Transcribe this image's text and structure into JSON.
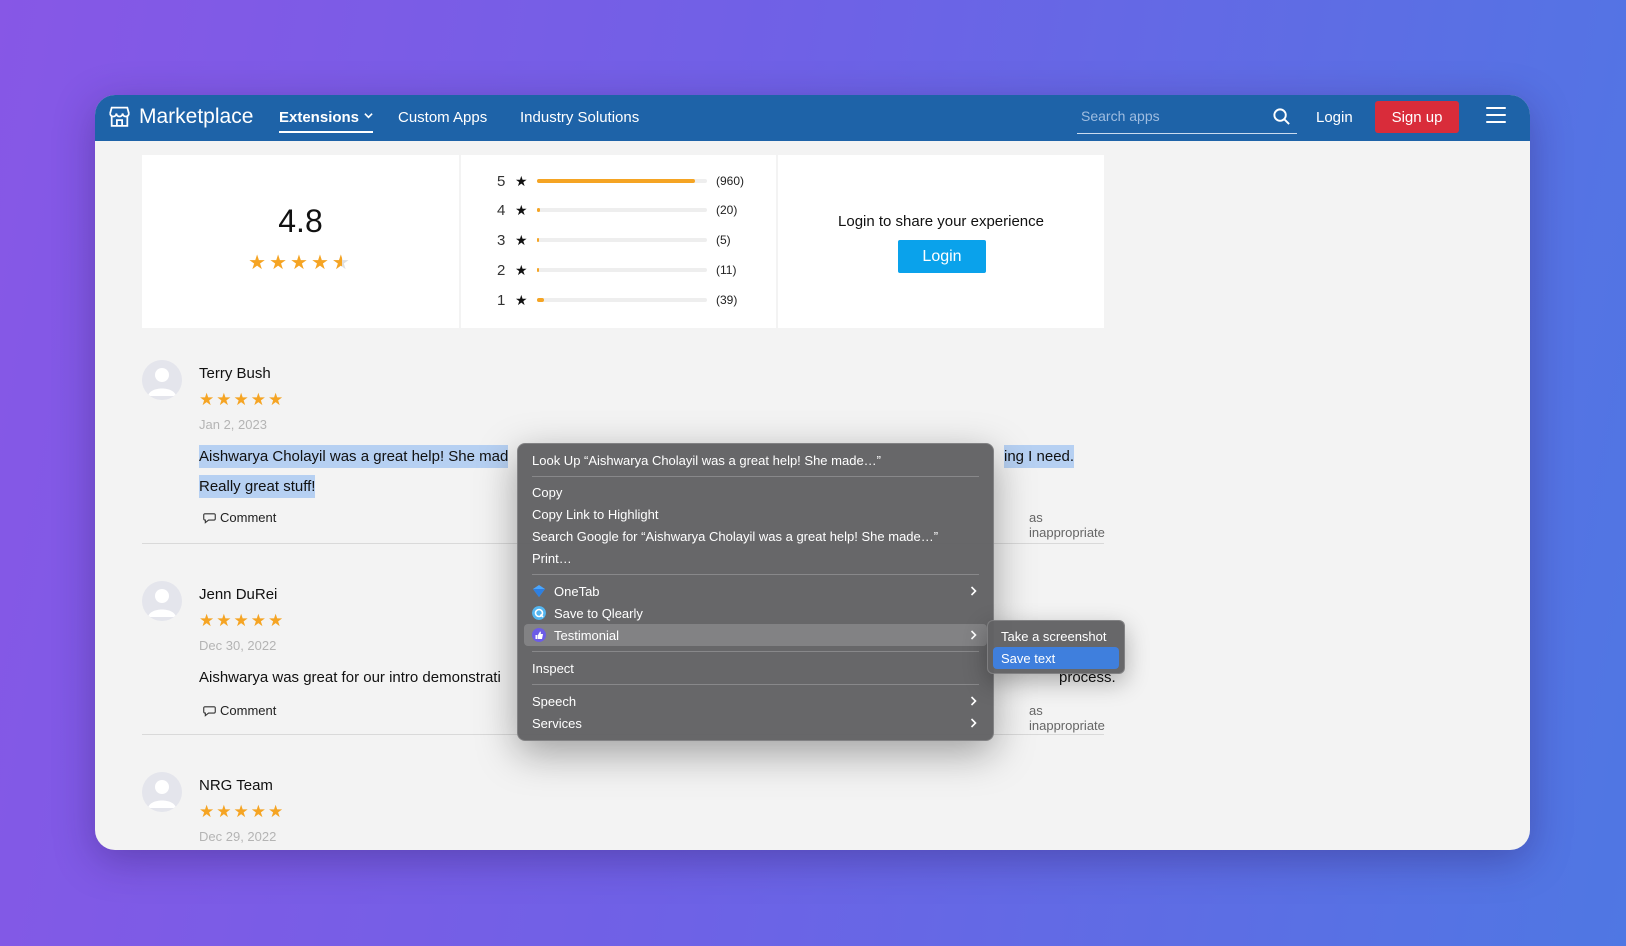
{
  "nav": {
    "brand": "Marketplace",
    "links": [
      "Extensions",
      "Custom Apps",
      "Industry Solutions"
    ],
    "search_placeholder": "Search apps",
    "login": "Login",
    "signup": "Sign up"
  },
  "summary": {
    "average": "4.8",
    "stars": "★★★★",
    "half_star": "★",
    "distribution": [
      {
        "stars": "5",
        "count": "(960)",
        "fraction": 0.93
      },
      {
        "stars": "4",
        "count": "(20)",
        "fraction": 0.02
      },
      {
        "stars": "3",
        "count": "(5)",
        "fraction": 0.005
      },
      {
        "stars": "2",
        "count": "(11)",
        "fraction": 0.01
      },
      {
        "stars": "1",
        "count": "(39)",
        "fraction": 0.04
      }
    ],
    "star_glyph": "★",
    "share_text": "Login to share your experience",
    "share_login": "Login"
  },
  "reviews": [
    {
      "name": "Terry Bush",
      "stars": "★★★★★",
      "date": "Jan 2, 2023",
      "text_line1_start": "Aishwarya Cholayil was a great help! She mad",
      "text_line1_end": "ing I need.",
      "text_line2": "Really great stuff!",
      "comment": "Comment",
      "report": "as inappropriate"
    },
    {
      "name": "Jenn DuRei",
      "stars": "★★★★★",
      "date": "Dec 30, 2022",
      "text_start": "Aishwarya was great for our intro demonstrati",
      "text_end": "process.",
      "comment": "Comment",
      "report": "as inappropriate"
    },
    {
      "name": "NRG Team",
      "stars": "★★★★★",
      "date": "Dec 29, 2022"
    }
  ],
  "context_menu": {
    "lookup": "Look Up “Aishwarya Cholayil was a great help! She made…”",
    "copy": "Copy",
    "copy_link": "Copy Link to Highlight",
    "search_google": "Search Google for “Aishwarya Cholayil was a great help! She made…”",
    "print": "Print…",
    "onetab": "OneTab",
    "qlearly": "Save to Qlearly",
    "testimonial": "Testimonial",
    "inspect": "Inspect",
    "speech": "Speech",
    "services": "Services",
    "submenu": {
      "screenshot": "Take a screenshot",
      "save_text": "Save text"
    }
  },
  "colors": {
    "nav": "#1e63a8",
    "accent_star": "#f5a423",
    "signup": "#d92c3a",
    "login_button": "#0aa2eb",
    "selection": "#b6d0f2",
    "menu_selected": "#3f7fdd"
  }
}
